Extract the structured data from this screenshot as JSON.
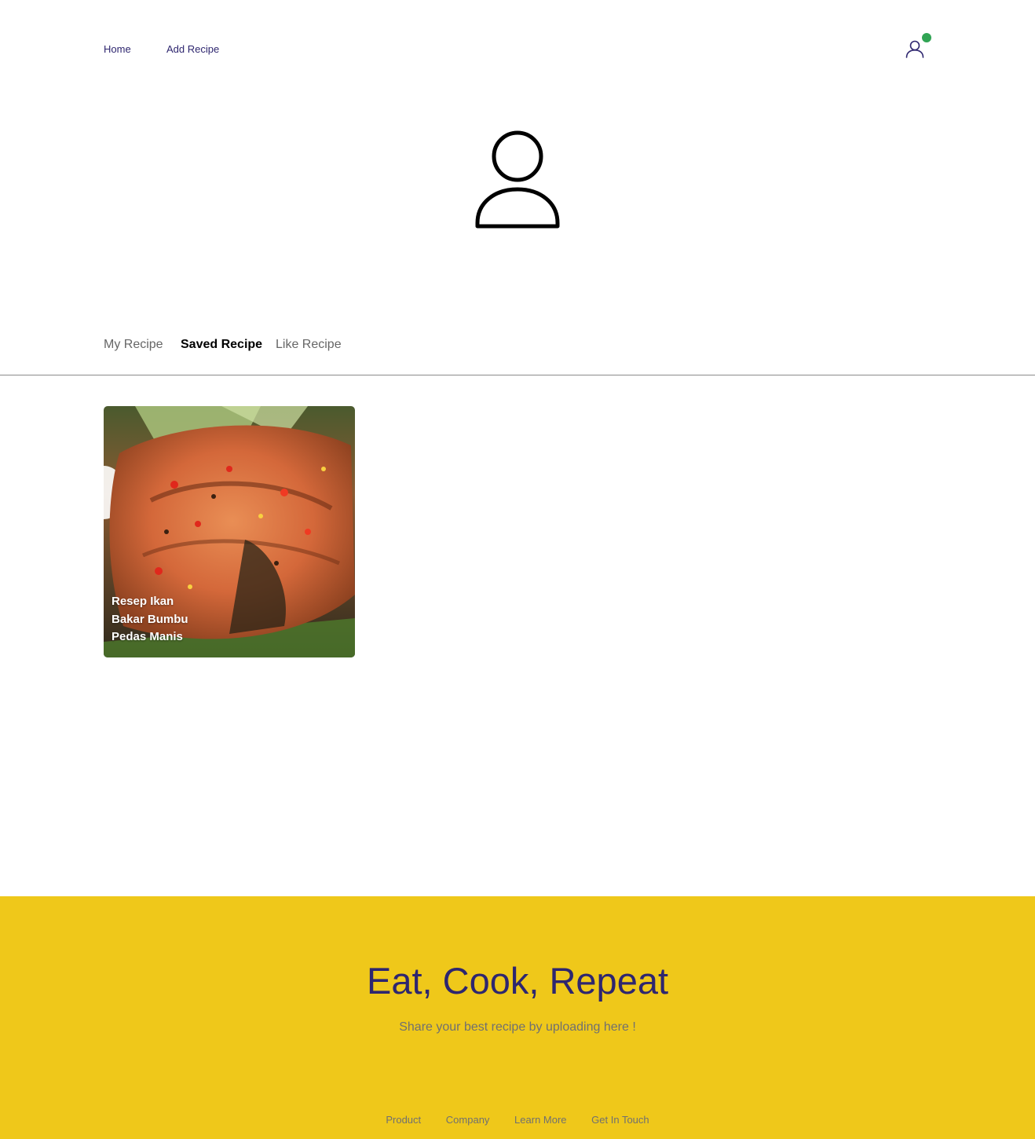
{
  "nav": {
    "home_label": "Home",
    "add_recipe_label": "Add Recipe",
    "user_icon": "user-icon",
    "online_status_color": "#30a454"
  },
  "profile": {
    "avatar_icon": "user-avatar-icon"
  },
  "tabs": [
    {
      "label": "My Recipe",
      "active": false
    },
    {
      "label": "Saved Recipe",
      "active": true
    },
    {
      "label": "Like Recipe",
      "active": false
    }
  ],
  "recipes": [
    {
      "title": "Resep Ikan Bakar Bumbu Pedas Manis"
    }
  ],
  "footer": {
    "heading": "Eat, Cook, Repeat",
    "subheading": "Share your best recipe by uploading here !",
    "links": [
      "Product",
      "Company",
      "Learn More",
      "Get In Touch"
    ],
    "background_color": "#efc81a",
    "heading_color": "#2e266f"
  }
}
